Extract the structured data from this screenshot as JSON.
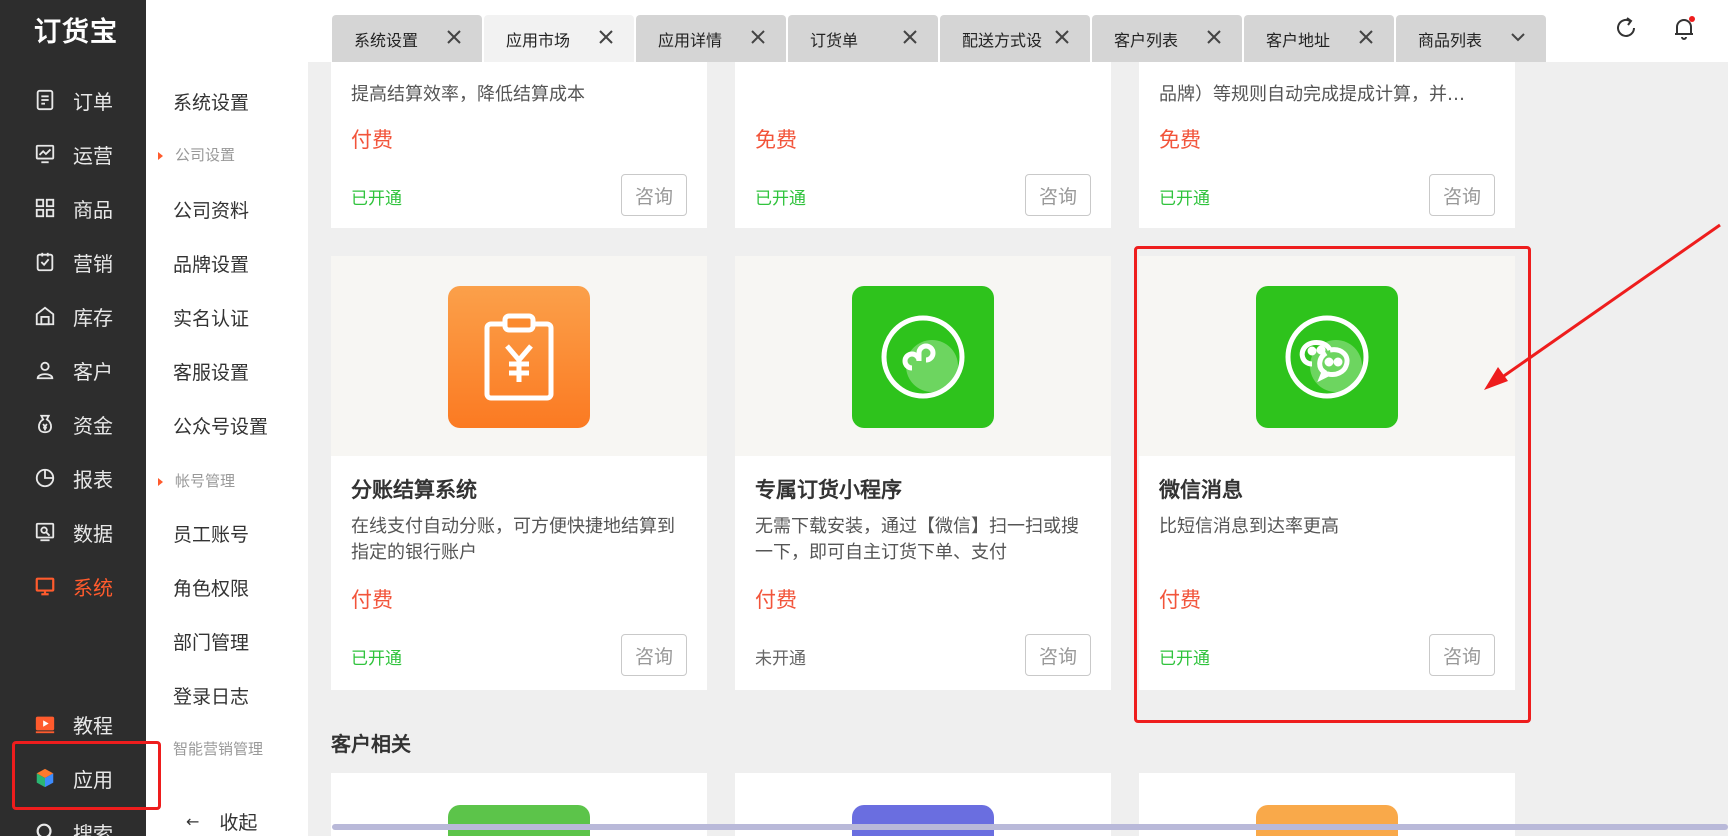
{
  "logo": "订货宝",
  "left_nav": [
    {
      "label": "订单",
      "icon": "order-icon"
    },
    {
      "label": "运营",
      "icon": "operations-icon"
    },
    {
      "label": "商品",
      "icon": "products-icon"
    },
    {
      "label": "营销",
      "icon": "marketing-icon"
    },
    {
      "label": "库存",
      "icon": "inventory-icon"
    },
    {
      "label": "客户",
      "icon": "customer-icon"
    },
    {
      "label": "资金",
      "icon": "funds-icon"
    },
    {
      "label": "报表",
      "icon": "report-icon"
    },
    {
      "label": "数据",
      "icon": "data-icon"
    },
    {
      "label": "系统",
      "icon": "system-icon",
      "active": true
    },
    {
      "label": "教程",
      "icon": "tutorial-icon"
    },
    {
      "label": "应用",
      "icon": "apps-icon"
    },
    {
      "label": "搜索",
      "icon": "search-icon"
    }
  ],
  "sub_nav": {
    "system_settings": "系统设置",
    "group_company": "公司设置",
    "company_profile": "公司资料",
    "brand_settings": "品牌设置",
    "real_name": "实名认证",
    "customer_service": "客服设置",
    "official_account": "公众号设置",
    "group_account": "帐号管理",
    "staff_account": "员工账号",
    "role_permissions": "角色权限",
    "department": "部门管理",
    "login_log": "登录日志",
    "smart_marketing": "智能营销管理",
    "collapse": "收起"
  },
  "tabs": [
    {
      "label": "系统设置"
    },
    {
      "label": "应用市场",
      "active": true
    },
    {
      "label": "应用详情"
    },
    {
      "label": "订货单"
    },
    {
      "label": "配送方式设"
    },
    {
      "label": "客户列表"
    },
    {
      "label": "客户地址"
    },
    {
      "label": "商品列表"
    }
  ],
  "cards_partial": [
    {
      "desc": "提高结算效率，降低结算成本",
      "price": "付费",
      "status": "已开通",
      "consult": "咨询"
    },
    {
      "desc": "",
      "price": "免费",
      "status": "已开通",
      "consult": "咨询"
    },
    {
      "desc": "品牌）等规则自动完成提成计算，并…",
      "price": "免费",
      "status": "已开通",
      "consult": "咨询"
    }
  ],
  "cards": [
    {
      "title": "分账结算系统",
      "desc": "在线支付自动分账，可方便快捷地结算到指定的银行账户",
      "price": "付费",
      "status": "已开通",
      "consult": "咨询",
      "color": "#fb8a2e"
    },
    {
      "title": "专属订货小程序",
      "desc": "无需下载安装，通过【微信】扫一扫或搜一下，即可自主订货下单、支付",
      "price": "付费",
      "status": "未开通",
      "consult": "咨询",
      "color": "#2ec31c"
    },
    {
      "title": "微信消息",
      "desc": "比短信消息到达率更高",
      "price": "付费",
      "status": "已开通",
      "consult": "咨询",
      "color": "#2ec31c"
    }
  ],
  "section_title": "客户相关",
  "colors": {
    "accent": "#ff5b2d",
    "price": "#f2543a",
    "enabled": "#30c33d",
    "annotation": "#ee1d1d"
  }
}
